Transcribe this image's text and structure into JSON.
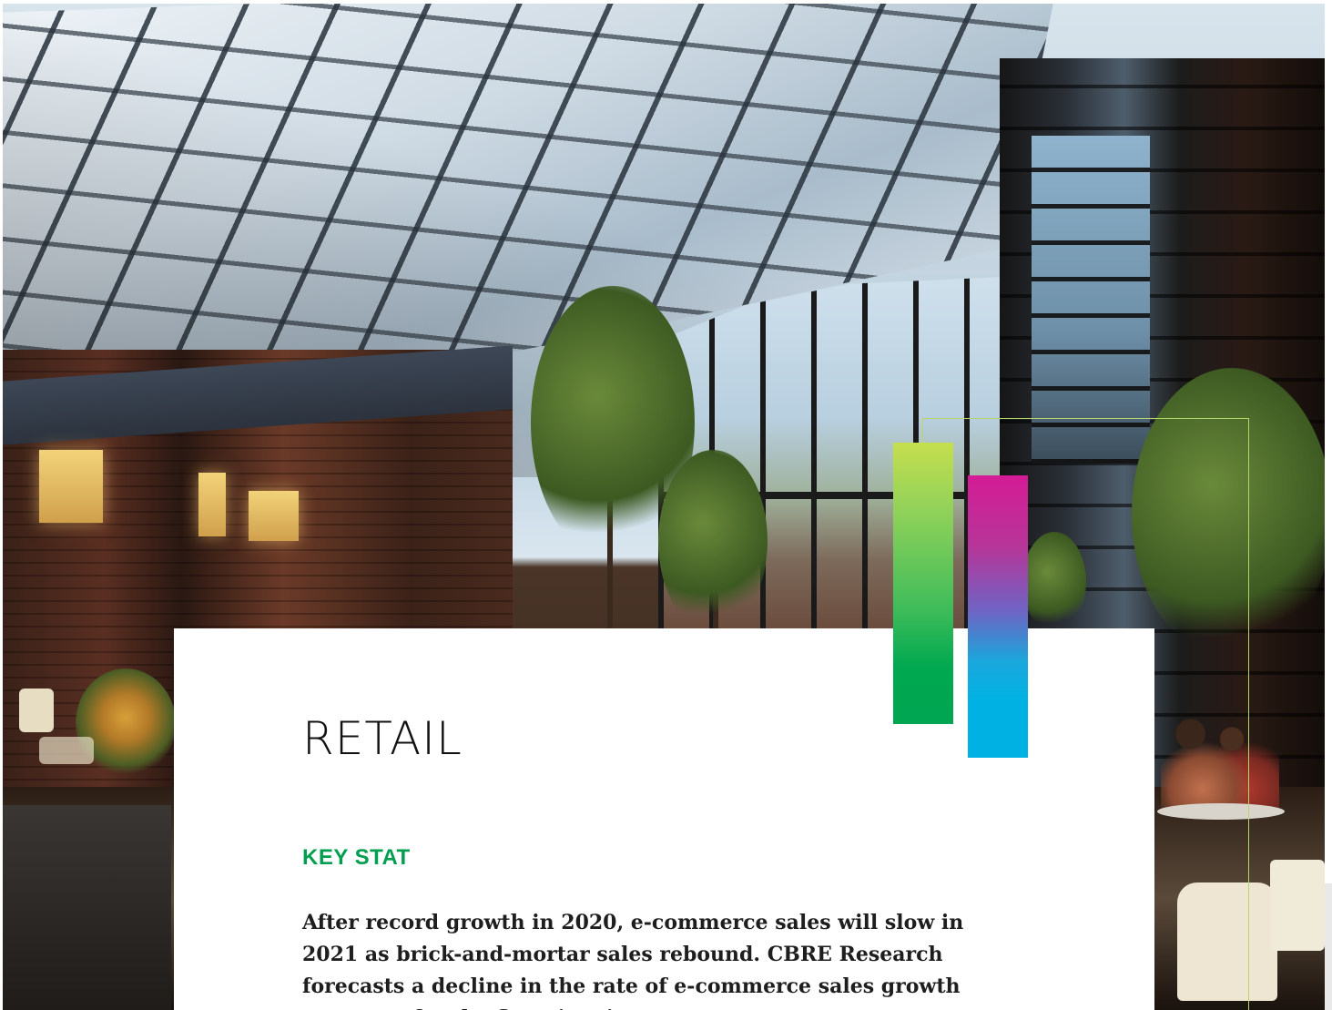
{
  "section": {
    "title": "RETAIL",
    "kicker": "KEY STAT",
    "body": "After record growth in 2020, e-commerce sales will slow in 2021 as brick-and-mortar sales rebound. CBRE Research forecasts a decline in the rate of e-commerce sales growth next year for the first time in"
  },
  "decor": {
    "bar_left_colors": [
      "#c5de4e",
      "#00a651"
    ],
    "bar_right_colors": [
      "#d41c96",
      "#00b2e3"
    ],
    "frame_color": "#b6d56a",
    "kicker_color": "#009f4f"
  },
  "photo": {
    "subject": "glass-roofed atrium interior"
  }
}
